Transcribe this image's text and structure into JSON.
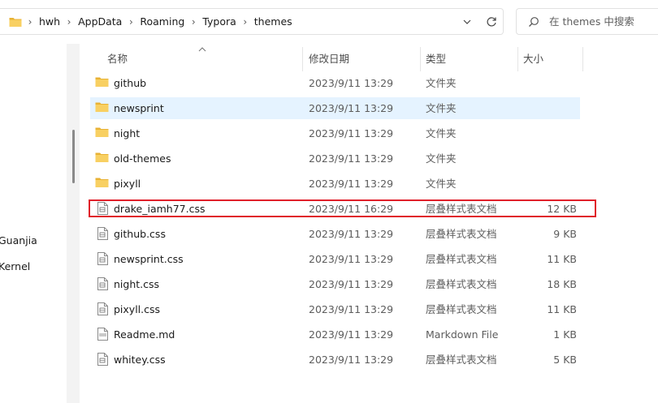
{
  "address_bar": {
    "crumbs": [
      "hwh",
      "AppData",
      "Roaming",
      "Typora",
      "themes"
    ],
    "separator": "›"
  },
  "search": {
    "placeholder": "在 themes 中搜索"
  },
  "nav_pane": {
    "items": [
      "Guanjia",
      "Kernel"
    ]
  },
  "columns": {
    "name": "名称",
    "date": "修改日期",
    "type": "类型",
    "size": "大小"
  },
  "files": [
    {
      "name": "github",
      "date": "2023/9/11 13:29",
      "type": "文件夹",
      "size": "",
      "icon": "folder-icon"
    },
    {
      "name": "newsprint",
      "date": "2023/9/11 13:29",
      "type": "文件夹",
      "size": "",
      "icon": "folder-icon",
      "selected": true
    },
    {
      "name": "night",
      "date": "2023/9/11 13:29",
      "type": "文件夹",
      "size": "",
      "icon": "folder-icon"
    },
    {
      "name": "old-themes",
      "date": "2023/9/11 13:29",
      "type": "文件夹",
      "size": "",
      "icon": "folder-icon"
    },
    {
      "name": "pixyll",
      "date": "2023/9/11 13:29",
      "type": "文件夹",
      "size": "",
      "icon": "folder-icon"
    },
    {
      "name": "drake_iamh77.css",
      "date": "2023/9/11 16:29",
      "type": "层叠样式表文档",
      "size": "12 KB",
      "icon": "css-file-icon",
      "highlighted": true
    },
    {
      "name": "github.css",
      "date": "2023/9/11 13:29",
      "type": "层叠样式表文档",
      "size": "9 KB",
      "icon": "css-file-icon"
    },
    {
      "name": "newsprint.css",
      "date": "2023/9/11 13:29",
      "type": "层叠样式表文档",
      "size": "11 KB",
      "icon": "css-file-icon"
    },
    {
      "name": "night.css",
      "date": "2023/9/11 13:29",
      "type": "层叠样式表文档",
      "size": "18 KB",
      "icon": "css-file-icon"
    },
    {
      "name": "pixyll.css",
      "date": "2023/9/11 13:29",
      "type": "层叠样式表文档",
      "size": "11 KB",
      "icon": "css-file-icon"
    },
    {
      "name": "Readme.md",
      "date": "2023/9/11 13:29",
      "type": "Markdown File",
      "size": "1 KB",
      "icon": "markdown-file-icon"
    },
    {
      "name": "whitey.css",
      "date": "2023/9/11 13:29",
      "type": "层叠样式表文档",
      "size": "5 KB",
      "icon": "css-file-icon"
    }
  ],
  "colors": {
    "selection": "#e5f3ff",
    "highlight_border": "#e0202a",
    "folder": "#f6c342"
  }
}
